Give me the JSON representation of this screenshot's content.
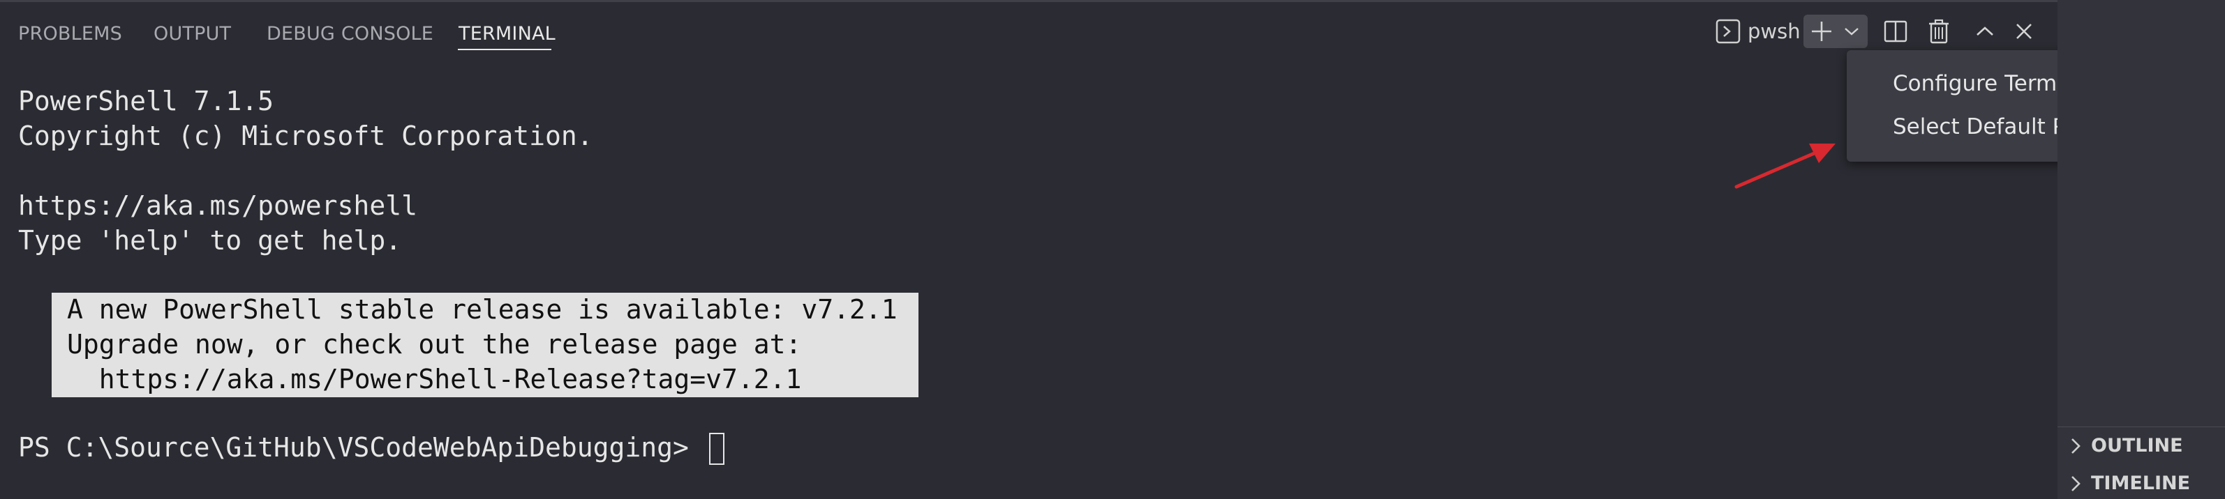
{
  "panel": {
    "tabs": [
      {
        "label": "PROBLEMS"
      },
      {
        "label": "OUTPUT"
      },
      {
        "label": "DEBUG CONSOLE"
      },
      {
        "label": "TERMINAL",
        "active": true
      }
    ]
  },
  "toolbar": {
    "profile_icon": "terminal-icon",
    "profile_label": "pwsh",
    "new_terminal_icon": "plus-icon",
    "launch_profile_icon": "chevron-down-icon",
    "split_icon": "split-editor-icon",
    "kill_icon": "trash-icon",
    "maximize_icon": "chevron-up-icon",
    "close_icon": "close-icon"
  },
  "terminal": {
    "lines": [
      "PowerShell 7.1.5",
      "Copyright (c) Microsoft Corporation.",
      "https://aka.ms/powershell",
      "Type 'help' to get help."
    ],
    "notice": [
      "A new PowerShell stable release is available: v7.2.1",
      "Upgrade now, or check out the release page at:",
      "  https://aka.ms/PowerShell-Release?tag=v7.2.1"
    ],
    "prompt": "PS C:\\Source\\GitHub\\VSCodeWebApiDebugging> "
  },
  "dropdown": {
    "items": [
      {
        "label": "Configure Terminal Settings"
      },
      {
        "label": "Select Default Profile"
      }
    ]
  },
  "sidebar": {
    "sections": [
      {
        "label": "OUTLINE"
      },
      {
        "label": "TIMELINE"
      }
    ]
  },
  "colors": {
    "background": "#2b2c33",
    "notice_background": "#e2e2e2",
    "menu_background": "#3b3c44",
    "annotation_arrow": "#d9282f"
  }
}
